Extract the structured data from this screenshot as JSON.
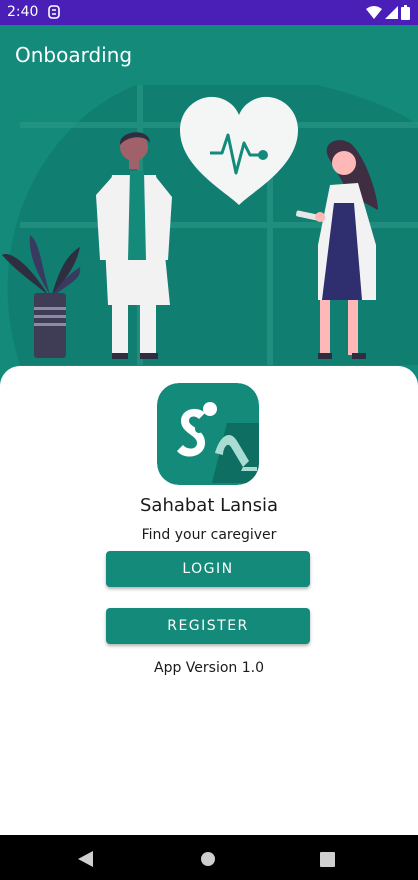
{
  "status_bar": {
    "time": "2:40",
    "icons": [
      "app-notification-icon",
      "wifi-icon",
      "signal-icon",
      "battery-icon"
    ]
  },
  "app_bar": {
    "title": "Onboarding"
  },
  "hero": {
    "illustration": "doctors-heart-illustration"
  },
  "card": {
    "logo": "sahabat-lansia-logo",
    "app_name": "Sahabat Lansia",
    "tagline": "Find your caregiver",
    "login_label": "LOGIN",
    "register_label": "REGISTER",
    "version": "App Version 1.0"
  },
  "nav_bar": {
    "icons": [
      "back-icon",
      "home-icon",
      "recents-icon"
    ]
  },
  "colors": {
    "status_bar": "#4a1fb8",
    "primary": "#138a7a",
    "on_primary": "#ffffff",
    "nav_bar": "#000000",
    "text": "#1a1a1a"
  }
}
